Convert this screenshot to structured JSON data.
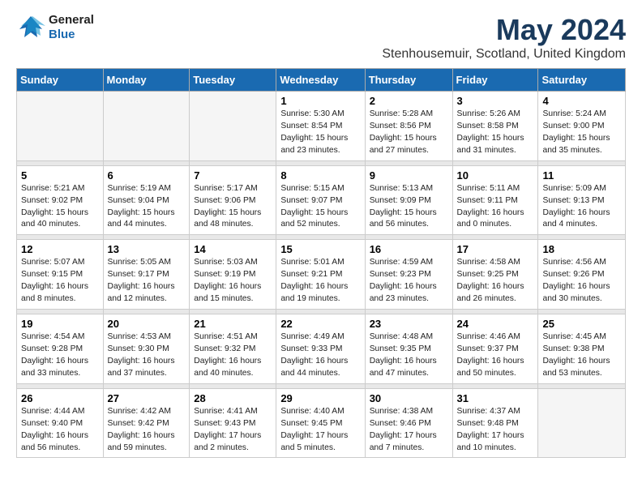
{
  "header": {
    "logo_general": "General",
    "logo_blue": "Blue",
    "month_title": "May 2024",
    "location": "Stenhousemuir, Scotland, United Kingdom"
  },
  "weekdays": [
    "Sunday",
    "Monday",
    "Tuesday",
    "Wednesday",
    "Thursday",
    "Friday",
    "Saturday"
  ],
  "weeks": [
    [
      {
        "day": "",
        "detail": ""
      },
      {
        "day": "",
        "detail": ""
      },
      {
        "day": "",
        "detail": ""
      },
      {
        "day": "1",
        "detail": "Sunrise: 5:30 AM\nSunset: 8:54 PM\nDaylight: 15 hours\nand 23 minutes."
      },
      {
        "day": "2",
        "detail": "Sunrise: 5:28 AM\nSunset: 8:56 PM\nDaylight: 15 hours\nand 27 minutes."
      },
      {
        "day": "3",
        "detail": "Sunrise: 5:26 AM\nSunset: 8:58 PM\nDaylight: 15 hours\nand 31 minutes."
      },
      {
        "day": "4",
        "detail": "Sunrise: 5:24 AM\nSunset: 9:00 PM\nDaylight: 15 hours\nand 35 minutes."
      }
    ],
    [
      {
        "day": "5",
        "detail": "Sunrise: 5:21 AM\nSunset: 9:02 PM\nDaylight: 15 hours\nand 40 minutes."
      },
      {
        "day": "6",
        "detail": "Sunrise: 5:19 AM\nSunset: 9:04 PM\nDaylight: 15 hours\nand 44 minutes."
      },
      {
        "day": "7",
        "detail": "Sunrise: 5:17 AM\nSunset: 9:06 PM\nDaylight: 15 hours\nand 48 minutes."
      },
      {
        "day": "8",
        "detail": "Sunrise: 5:15 AM\nSunset: 9:07 PM\nDaylight: 15 hours\nand 52 minutes."
      },
      {
        "day": "9",
        "detail": "Sunrise: 5:13 AM\nSunset: 9:09 PM\nDaylight: 15 hours\nand 56 minutes."
      },
      {
        "day": "10",
        "detail": "Sunrise: 5:11 AM\nSunset: 9:11 PM\nDaylight: 16 hours\nand 0 minutes."
      },
      {
        "day": "11",
        "detail": "Sunrise: 5:09 AM\nSunset: 9:13 PM\nDaylight: 16 hours\nand 4 minutes."
      }
    ],
    [
      {
        "day": "12",
        "detail": "Sunrise: 5:07 AM\nSunset: 9:15 PM\nDaylight: 16 hours\nand 8 minutes."
      },
      {
        "day": "13",
        "detail": "Sunrise: 5:05 AM\nSunset: 9:17 PM\nDaylight: 16 hours\nand 12 minutes."
      },
      {
        "day": "14",
        "detail": "Sunrise: 5:03 AM\nSunset: 9:19 PM\nDaylight: 16 hours\nand 15 minutes."
      },
      {
        "day": "15",
        "detail": "Sunrise: 5:01 AM\nSunset: 9:21 PM\nDaylight: 16 hours\nand 19 minutes."
      },
      {
        "day": "16",
        "detail": "Sunrise: 4:59 AM\nSunset: 9:23 PM\nDaylight: 16 hours\nand 23 minutes."
      },
      {
        "day": "17",
        "detail": "Sunrise: 4:58 AM\nSunset: 9:25 PM\nDaylight: 16 hours\nand 26 minutes."
      },
      {
        "day": "18",
        "detail": "Sunrise: 4:56 AM\nSunset: 9:26 PM\nDaylight: 16 hours\nand 30 minutes."
      }
    ],
    [
      {
        "day": "19",
        "detail": "Sunrise: 4:54 AM\nSunset: 9:28 PM\nDaylight: 16 hours\nand 33 minutes."
      },
      {
        "day": "20",
        "detail": "Sunrise: 4:53 AM\nSunset: 9:30 PM\nDaylight: 16 hours\nand 37 minutes."
      },
      {
        "day": "21",
        "detail": "Sunrise: 4:51 AM\nSunset: 9:32 PM\nDaylight: 16 hours\nand 40 minutes."
      },
      {
        "day": "22",
        "detail": "Sunrise: 4:49 AM\nSunset: 9:33 PM\nDaylight: 16 hours\nand 44 minutes."
      },
      {
        "day": "23",
        "detail": "Sunrise: 4:48 AM\nSunset: 9:35 PM\nDaylight: 16 hours\nand 47 minutes."
      },
      {
        "day": "24",
        "detail": "Sunrise: 4:46 AM\nSunset: 9:37 PM\nDaylight: 16 hours\nand 50 minutes."
      },
      {
        "day": "25",
        "detail": "Sunrise: 4:45 AM\nSunset: 9:38 PM\nDaylight: 16 hours\nand 53 minutes."
      }
    ],
    [
      {
        "day": "26",
        "detail": "Sunrise: 4:44 AM\nSunset: 9:40 PM\nDaylight: 16 hours\nand 56 minutes."
      },
      {
        "day": "27",
        "detail": "Sunrise: 4:42 AM\nSunset: 9:42 PM\nDaylight: 16 hours\nand 59 minutes."
      },
      {
        "day": "28",
        "detail": "Sunrise: 4:41 AM\nSunset: 9:43 PM\nDaylight: 17 hours\nand 2 minutes."
      },
      {
        "day": "29",
        "detail": "Sunrise: 4:40 AM\nSunset: 9:45 PM\nDaylight: 17 hours\nand 5 minutes."
      },
      {
        "day": "30",
        "detail": "Sunrise: 4:38 AM\nSunset: 9:46 PM\nDaylight: 17 hours\nand 7 minutes."
      },
      {
        "day": "31",
        "detail": "Sunrise: 4:37 AM\nSunset: 9:48 PM\nDaylight: 17 hours\nand 10 minutes."
      },
      {
        "day": "",
        "detail": ""
      }
    ]
  ]
}
